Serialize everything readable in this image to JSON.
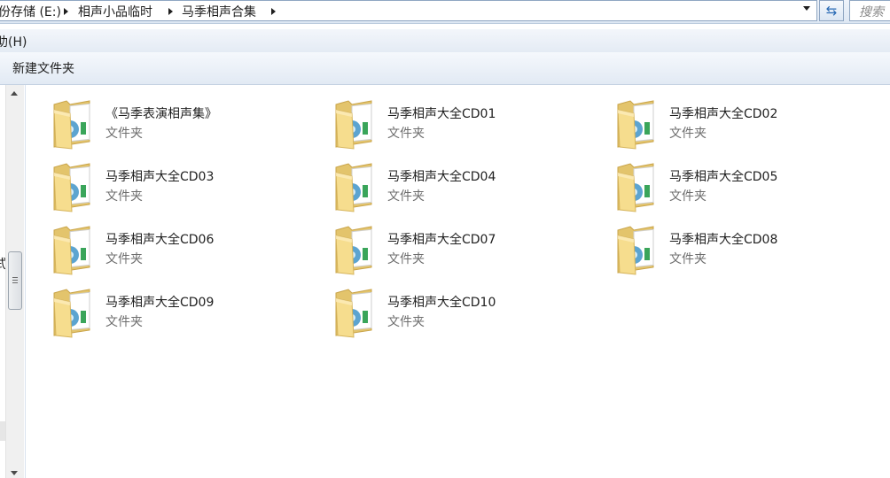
{
  "address_bar": {
    "crumbs": [
      "份存储 (E:)",
      "相声小品临时",
      "马季相声合集"
    ]
  },
  "search": {
    "placeholder": "搜索"
  },
  "menu": {
    "partial_item": "助(H)"
  },
  "toolbar": {
    "new_folder_label": "新建文件夹"
  },
  "nav_pane": {
    "partial_text": "式"
  },
  "folders": [
    {
      "name": "《马季表演相声集》",
      "type": "文件夹"
    },
    {
      "name": "马季相声大全CD01",
      "type": "文件夹"
    },
    {
      "name": "马季相声大全CD02",
      "type": "文件夹"
    },
    {
      "name": "马季相声大全CD03",
      "type": "文件夹"
    },
    {
      "name": "马季相声大全CD04",
      "type": "文件夹"
    },
    {
      "name": "马季相声大全CD05",
      "type": "文件夹"
    },
    {
      "name": "马季相声大全CD06",
      "type": "文件夹"
    },
    {
      "name": "马季相声大全CD07",
      "type": "文件夹"
    },
    {
      "name": "马季相声大全CD08",
      "type": "文件夹"
    },
    {
      "name": "马季相声大全CD09",
      "type": "文件夹"
    },
    {
      "name": "马季相声大全CD10",
      "type": "文件夹"
    }
  ],
  "colors": {
    "folder_back": "#e3c46c",
    "folder_front": "#f6dd8e",
    "disc_blue": "#3f94c8",
    "accent_blue": "#2a6bb5"
  },
  "icons": {
    "folder": "folder-with-media-icon",
    "refresh": "refresh-icon",
    "breadcrumb_separator": "chevron-right-icon",
    "dropdown": "chevron-down-icon"
  }
}
